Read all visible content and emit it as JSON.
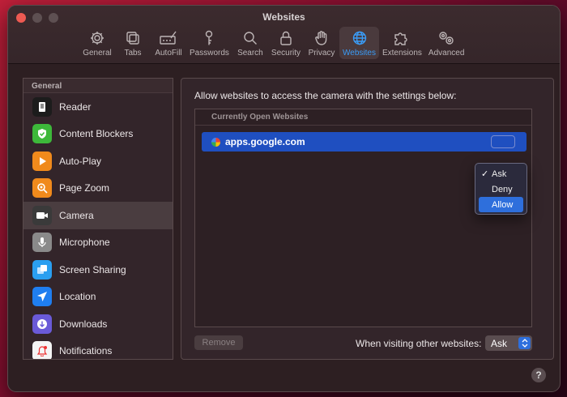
{
  "window": {
    "title": "Websites"
  },
  "toolbar": {
    "items": [
      {
        "label": "General",
        "icon": "gear-icon"
      },
      {
        "label": "Tabs",
        "icon": "tabs-icon"
      },
      {
        "label": "AutoFill",
        "icon": "autofill-icon"
      },
      {
        "label": "Passwords",
        "icon": "key-icon"
      },
      {
        "label": "Search",
        "icon": "search-icon"
      },
      {
        "label": "Security",
        "icon": "lock-icon"
      },
      {
        "label": "Privacy",
        "icon": "hand-icon"
      },
      {
        "label": "Websites",
        "icon": "globe-icon"
      },
      {
        "label": "Extensions",
        "icon": "puzzle-icon"
      },
      {
        "label": "Advanced",
        "icon": "gears-icon"
      }
    ],
    "active": "Websites",
    "active_color": "#3a9cf7"
  },
  "sidebar": {
    "header": "General",
    "items": [
      {
        "label": "Reader",
        "icon": "reader-icon",
        "color": "#1c1c1c"
      },
      {
        "label": "Content Blockers",
        "icon": "shield-check-icon",
        "color": "#3db83a"
      },
      {
        "label": "Auto-Play",
        "icon": "play-icon",
        "color": "#f08a1c"
      },
      {
        "label": "Page Zoom",
        "icon": "zoom-icon",
        "color": "#f08a1c"
      },
      {
        "label": "Camera",
        "icon": "camera-icon",
        "color": "#3a3a3a"
      },
      {
        "label": "Microphone",
        "icon": "microphone-icon",
        "color": "#8a8a8a"
      },
      {
        "label": "Screen Sharing",
        "icon": "screen-sharing-icon",
        "color": "#2a9ff0"
      },
      {
        "label": "Location",
        "icon": "location-icon",
        "color": "#1f7ef0"
      },
      {
        "label": "Downloads",
        "icon": "download-icon",
        "color": "#6a5ad8"
      },
      {
        "label": "Notifications",
        "icon": "notification-icon",
        "color": "#f5f5f5"
      }
    ],
    "selected": "Camera"
  },
  "panel": {
    "description": "Allow websites to access the camera with the settings below:",
    "list_header": "Currently Open Websites",
    "sites": [
      {
        "domain": "apps.google.com",
        "setting": "Ask"
      }
    ],
    "dropdown": {
      "options": [
        "Ask",
        "Deny",
        "Allow"
      ],
      "checked": "Ask",
      "highlighted": "Allow"
    },
    "remove_label": "Remove",
    "other_label": "When visiting other websites:",
    "other_value": "Ask"
  },
  "help": {
    "label": "?"
  }
}
